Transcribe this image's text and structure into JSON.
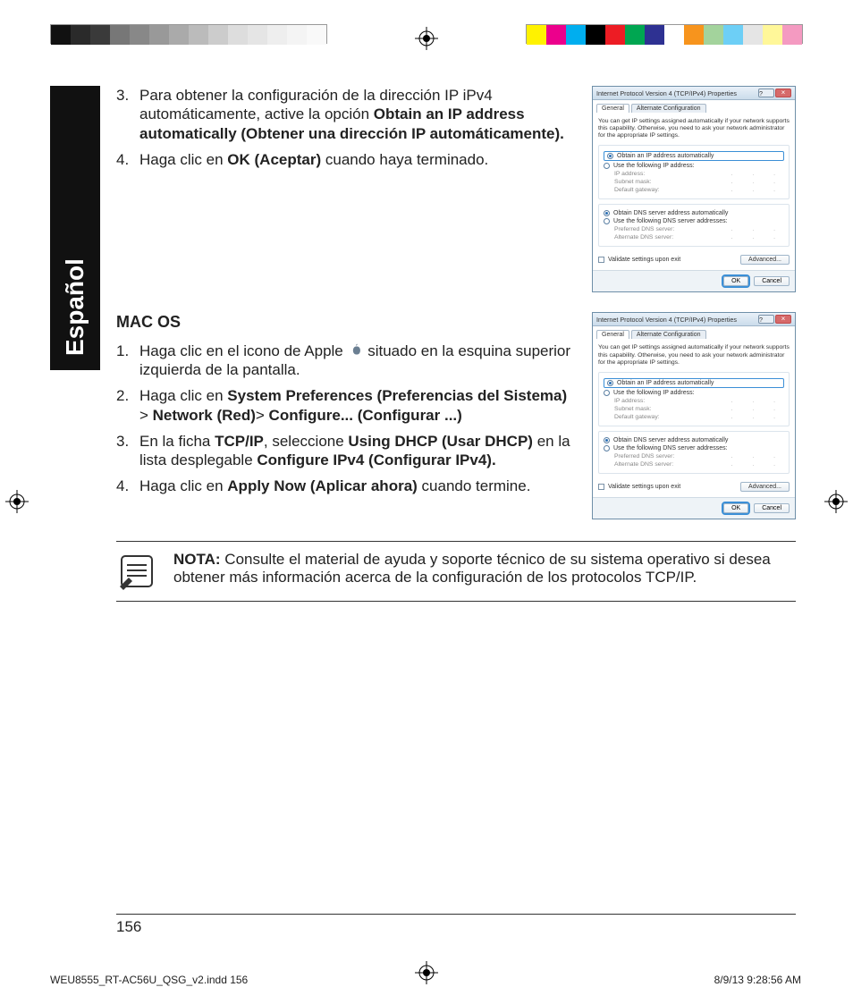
{
  "language_tab": "Español",
  "steps_windows": [
    {
      "num": "3.",
      "text_pre": "Para obtener la configuración de la dirección IP iPv4 automáticamente, active la opción ",
      "bold": "Obtain an IP address automatically (Obtener una dirección IP automáticamente).",
      "text_post": ""
    },
    {
      "num": "4.",
      "text_pre": "Haga clic en ",
      "bold": "OK (Aceptar)",
      "text_post": " cuando haya terminado."
    }
  ],
  "macos_heading": "MAC OS",
  "steps_mac": [
    {
      "num": "1.",
      "text_pre": "Haga clic en el icono de Apple ",
      "has_icon": true,
      "text_post": " situado en la esquina superior izquierda de la pantalla."
    },
    {
      "num": "2.",
      "text_pre": "Haga clic en ",
      "bold": "System Preferences (Preferencias del Sistema)",
      "sep": " > ",
      "bold2": "Network (Red)",
      "sep2": "> ",
      "bold3": "Configure... (Configurar ...)"
    },
    {
      "num": "3.",
      "text_pre": "En la ficha ",
      "bold": "TCP/IP",
      "mid": ", seleccione ",
      "bold2": "Using DHCP (Usar DHCP)",
      "mid2": " en la lista desplegable ",
      "bold3": "Configure IPv4 (Configurar IPv4)."
    },
    {
      "num": "4.",
      "text_pre": "Haga clic en ",
      "bold": "Apply Now (Aplicar ahora)",
      "text_post": " cuando termine."
    }
  ],
  "note_label": "NOTA:",
  "note_text": " Consulte el material de ayuda y soporte técnico de su sistema operativo si desea obtener más información acerca de la configuración de los protocolos TCP/IP.",
  "page_number": "156",
  "slug_left": "WEU8555_RT-AC56U_QSG_v2.indd   156",
  "slug_right": "8/9/13   9:28:56 AM",
  "dialog": {
    "title": "Internet Protocol Version 4 (TCP/IPv4) Properties",
    "tab_general": "General",
    "tab_alt": "Alternate Configuration",
    "desc": "You can get IP settings assigned automatically if your network supports this capability. Otherwise, you need to ask your network administrator for the appropriate IP settings.",
    "r_obtain_ip": "Obtain an IP address automatically",
    "r_use_ip": "Use the following IP address:",
    "f_ip": "IP address:",
    "f_mask": "Subnet mask:",
    "f_gw": "Default gateway:",
    "r_obtain_dns": "Obtain DNS server address automatically",
    "r_use_dns": "Use the following DNS server addresses:",
    "f_pdns": "Preferred DNS server:",
    "f_adns": "Alternate DNS server:",
    "chk_validate": "Validate settings upon exit",
    "btn_adv": "Advanced...",
    "btn_ok": "OK",
    "btn_cancel": "Cancel"
  }
}
